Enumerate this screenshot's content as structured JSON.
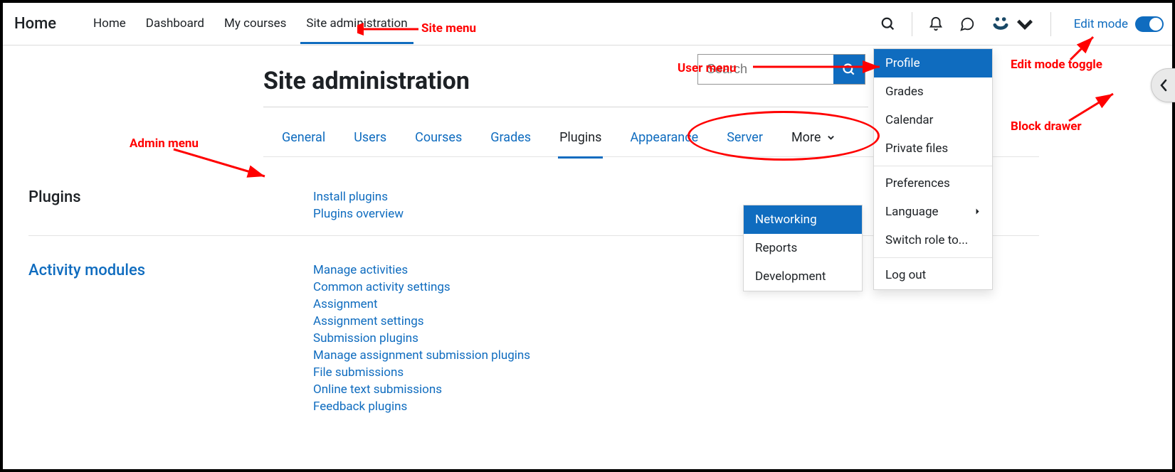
{
  "brand": "Home",
  "nav": [
    {
      "label": "Home",
      "active": false
    },
    {
      "label": "Dashboard",
      "active": false
    },
    {
      "label": "My courses",
      "active": false
    },
    {
      "label": "Site administration",
      "active": true
    }
  ],
  "edit_mode": {
    "label": "Edit mode",
    "on": true
  },
  "page_title": "Site administration",
  "search": {
    "placeholder": "Search"
  },
  "admin_tabs": [
    {
      "label": "General",
      "kind": "link"
    },
    {
      "label": "Users",
      "kind": "link"
    },
    {
      "label": "Courses",
      "kind": "link"
    },
    {
      "label": "Grades",
      "kind": "link"
    },
    {
      "label": "Plugins",
      "kind": "current"
    },
    {
      "label": "Appearance",
      "kind": "link"
    },
    {
      "label": "Server",
      "kind": "link"
    },
    {
      "label": "More",
      "kind": "more"
    }
  ],
  "more_dropdown": [
    {
      "label": "Networking",
      "selected": true
    },
    {
      "label": "Reports",
      "selected": false
    },
    {
      "label": "Development",
      "selected": false
    }
  ],
  "user_dropdown": {
    "group1": [
      {
        "label": "Profile",
        "selected": true
      },
      {
        "label": "Grades"
      },
      {
        "label": "Calendar"
      },
      {
        "label": "Private files"
      }
    ],
    "group2": [
      {
        "label": "Preferences"
      },
      {
        "label": "Language",
        "submenu": true
      },
      {
        "label": "Switch role to..."
      }
    ],
    "group3": [
      {
        "label": "Log out"
      }
    ]
  },
  "sections": [
    {
      "heading": "Plugins",
      "heading_link": false,
      "links": [
        {
          "text": "Install plugins",
          "indent": 0
        },
        {
          "text": "Plugins overview",
          "indent": 0
        }
      ]
    },
    {
      "heading": "Activity modules",
      "heading_link": true,
      "links": [
        {
          "text": "Manage activities",
          "indent": 0
        },
        {
          "text": "Common activity settings",
          "indent": 0
        },
        {
          "text": "Assignment",
          "indent": 0
        },
        {
          "text": "Assignment settings",
          "indent": 1
        },
        {
          "text": "Submission plugins",
          "indent": 1
        },
        {
          "text": "Manage assignment submission plugins",
          "indent": 2
        },
        {
          "text": "File submissions",
          "indent": 2
        },
        {
          "text": "Online text submissions",
          "indent": 2
        },
        {
          "text": "Feedback plugins",
          "indent": 1
        }
      ]
    }
  ],
  "annotations": {
    "site_menu": "Site menu",
    "admin_menu": "Admin menu",
    "user_menu": "User menu",
    "edit_toggle": "Edit mode toggle",
    "block_drawer": "Block drawer"
  }
}
